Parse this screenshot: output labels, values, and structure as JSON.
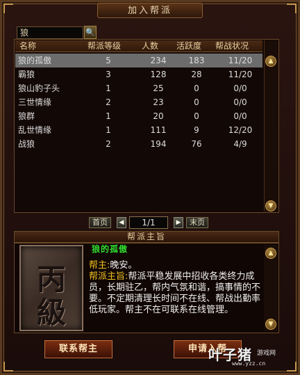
{
  "window": {
    "title": "加入帮派"
  },
  "search": {
    "value": "狼",
    "button_icon": "search-icon"
  },
  "table": {
    "headers": [
      "名称",
      "帮派等级",
      "人数",
      "活跃度",
      "帮战状况"
    ],
    "rows": [
      {
        "name": "狼的孤傲",
        "level": "5",
        "members": "234",
        "activity": "183",
        "war": "11/20",
        "selected": true
      },
      {
        "name": "霸狼",
        "level": "3",
        "members": "128",
        "activity": "28",
        "war": "11/20"
      },
      {
        "name": "狼山豹子头",
        "level": "1",
        "members": "25",
        "activity": "0",
        "war": "0/0"
      },
      {
        "name": "三世情缘",
        "level": "2",
        "members": "23",
        "activity": "0",
        "war": "0/0"
      },
      {
        "name": "狼群",
        "level": "1",
        "members": "20",
        "activity": "0",
        "war": "0/0"
      },
      {
        "name": "乱世情缘",
        "level": "1",
        "members": "111",
        "activity": "9",
        "war": "12/20"
      },
      {
        "name": "战狼",
        "level": "2",
        "members": "194",
        "activity": "76",
        "war": "4/9"
      }
    ]
  },
  "pager": {
    "first_label": "首页",
    "last_label": "末页",
    "page": "1/1"
  },
  "info": {
    "section_title": "帮派主旨",
    "emblem_chars": [
      "丙",
      "級"
    ],
    "guild_name": "狼的孤傲",
    "leader_label": "帮主:",
    "leader_name": "晚安。",
    "tenet_label": "帮派主旨:",
    "tenet_text": "帮派平稳发展中招收各类终力成员，长期驻乙，帮内气氛和谐，搞事情的不要。不定期清理长时间不在线、帮战出勤率低玩家。帮主不在可联系在线管理。"
  },
  "buttons": {
    "contact": "联系帮主",
    "apply": "申请入帮"
  },
  "watermark": {
    "brand": "叶子猪",
    "sub": "游戏网",
    "url": "www.yzz.cn"
  },
  "colors": {
    "accent": "#f0c020",
    "guild_name": "#30e030",
    "selected_row": "#6c6c6c"
  }
}
